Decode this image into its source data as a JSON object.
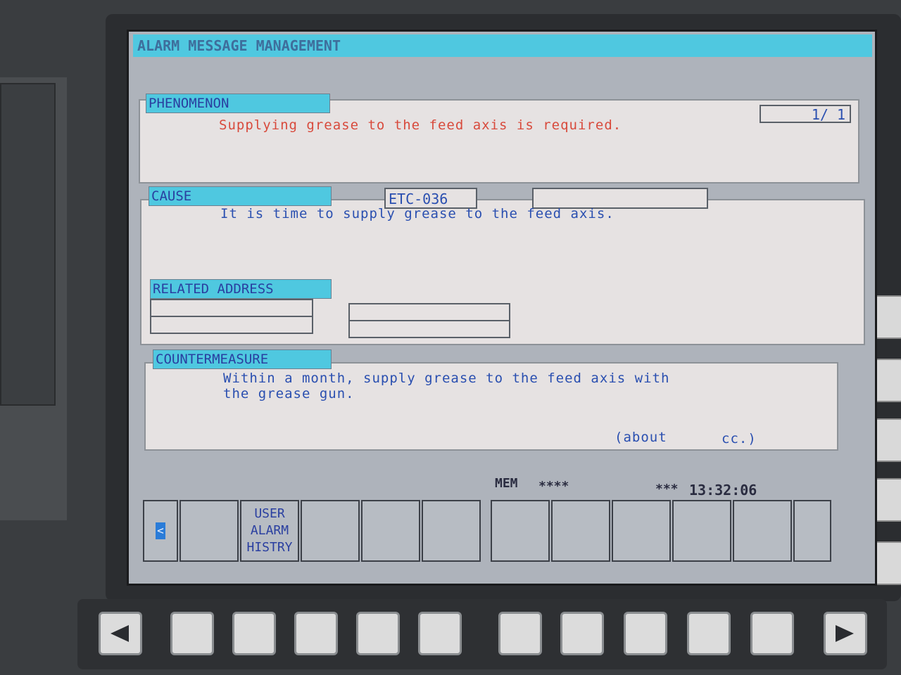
{
  "window": {
    "title": "ALARM MESSAGE MANAGEMENT"
  },
  "phenomenon": {
    "label": "PHENOMENON",
    "text": "Supplying grease to the feed axis is required.",
    "page": "1/ 1"
  },
  "cause": {
    "label": "CAUSE",
    "code": "ETC-036",
    "text": "It is time to supply grease to the feed axis."
  },
  "related_address": {
    "label": "RELATED ADDRESS"
  },
  "countermeasure": {
    "label": "COUNTERMEASURE",
    "line1": "Within a month, supply grease to the feed axis with",
    "line2": "the grease gun.",
    "about": "(about",
    "unit": "cc.)"
  },
  "status_bar": {
    "mode": "MEM",
    "stars1": "****",
    "stars2": "***",
    "time": "13:32:06"
  },
  "softkeys": {
    "back_arrow": "<",
    "user_alarm_history": [
      "USER",
      "ALARM",
      "HISTRY"
    ]
  },
  "colors": {
    "screen_bg": "#aeb3bb",
    "header_cyan": "#4fc8e0",
    "panel_bg": "#e6e2e2",
    "phenomenon_text": "#d84a3c",
    "body_text": "#2a4fb0"
  }
}
